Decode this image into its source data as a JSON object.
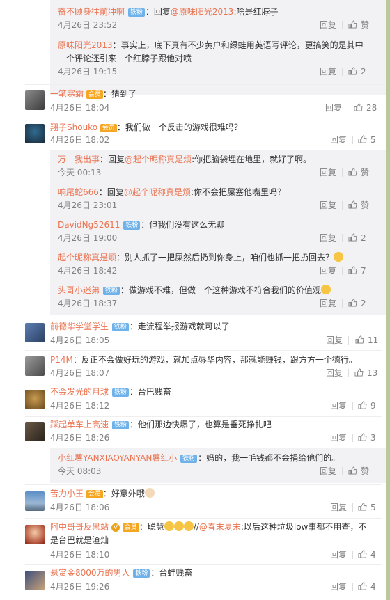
{
  "labels": {
    "reply": "回复",
    "like": "赞",
    "fans_badge": "铁粉",
    "vip_badge": "会员"
  },
  "comments": [
    {
      "kind": "sub",
      "name": "奋不顾身往前冲啊",
      "badge": true,
      "text": "回复@原味阳光2013:啥是红脖子",
      "mention": "@原味阳光2013",
      "rest": ":啥是红脖子",
      "time": "4月26日 23:52",
      "likes": "赞"
    },
    {
      "kind": "sub",
      "name": "原味阳光2013",
      "line1": "事实上，底下真有不少黄户和绿蛙用英语写评论，更搞笑的是其中",
      "line2": "一个评论还引来一个红脖子跟他对喷",
      "time": "4月26日 19:15",
      "likes": "2"
    },
    {
      "kind": "main",
      "name": "一笔寒霜",
      "vip": true,
      "text": "猜到了",
      "time": "4月26日 18:04",
      "likes": "28"
    },
    {
      "kind": "main",
      "name": "翔子Shouko",
      "vip": true,
      "text": "我们做一个反击的游戏很难吗？",
      "time": "4月26日 18:02",
      "likes": "5"
    },
    {
      "kind": "sub",
      "name": "万一我出事",
      "mention": "@起个昵称真是烦",
      "pre": "回复",
      "rest": ":你把脑袋埋在地里，就好了啊。",
      "time": "今天 00:13",
      "likes": "赞"
    },
    {
      "kind": "sub",
      "name": "响尾蛇666",
      "mention": "@起个昵称真是烦",
      "pre": "回复",
      "rest": ":你不会把屎塞他嘴里吗？",
      "time": "4月26日 23:01",
      "likes": "赞"
    },
    {
      "kind": "sub",
      "name": "DavidNg52611",
      "badge": true,
      "text": "但我们没有这么无聊",
      "time": "4月26日 19:00",
      "likes": "2"
    },
    {
      "kind": "sub",
      "name": "起个昵称真是烦",
      "text": "别人抓了一把屎然后扔到你身上，咱们也抓一把扔回去？",
      "time": "4月26日 18:42",
      "likes": "7"
    },
    {
      "kind": "sub",
      "name": "头哥小迷弟",
      "badge": true,
      "text": "做游戏不难，但做一个这种游戏不符合我们的价值观",
      "time": "4月26日 18:37",
      "likes": "2"
    },
    {
      "kind": "main",
      "name": "前德华学堂学生",
      "badge": true,
      "text": "走流程举报游戏就可以了",
      "time": "4月26日 18:05",
      "likes": "11"
    },
    {
      "kind": "main",
      "name": "P14M",
      "text": "反正不会做好玩的游戏，就加点辱华内容，那就能赚钱，跟方方一个德行。",
      "time": "4月26日 18:07",
      "likes": "13"
    },
    {
      "kind": "main",
      "name": "不会发光的月球",
      "badge": true,
      "text": "台巴贱畜",
      "time": "4月26日 18:12",
      "likes": "9"
    },
    {
      "kind": "main",
      "name": "踩起单车上高速",
      "badge": true,
      "text": "他们那边快爆了，也算是垂死挣扎吧",
      "time": "4月26日 18:26",
      "likes": "3"
    },
    {
      "kind": "sub",
      "name": "小红薯YANXIAOYANYAN薯红小",
      "badge": true,
      "text": "妈的，我一毛钱都不会捐给他们的。",
      "time": "今天 08:03",
      "likes": "赞"
    },
    {
      "kind": "main",
      "name": "苦力小王",
      "vip": true,
      "text": "好意外哦",
      "time": "4月26日 18:06",
      "likes": "5"
    },
    {
      "kind": "main",
      "name": "阿中哥哥反黑站",
      "vip": true,
      "line1a": "聪慧",
      "mention": "@春末夏末",
      "line1b": ":以后这种垃圾low事都不用查，不",
      "line2": "是台巴就是渣灿",
      "time": "4月26日 18:10",
      "likes": "4"
    },
    {
      "kind": "main",
      "name": "悬赏金8000万的男人",
      "badge": true,
      "text": "台蛙贱畜",
      "time": "4月26日 19:26",
      "likes": "4"
    }
  ]
}
